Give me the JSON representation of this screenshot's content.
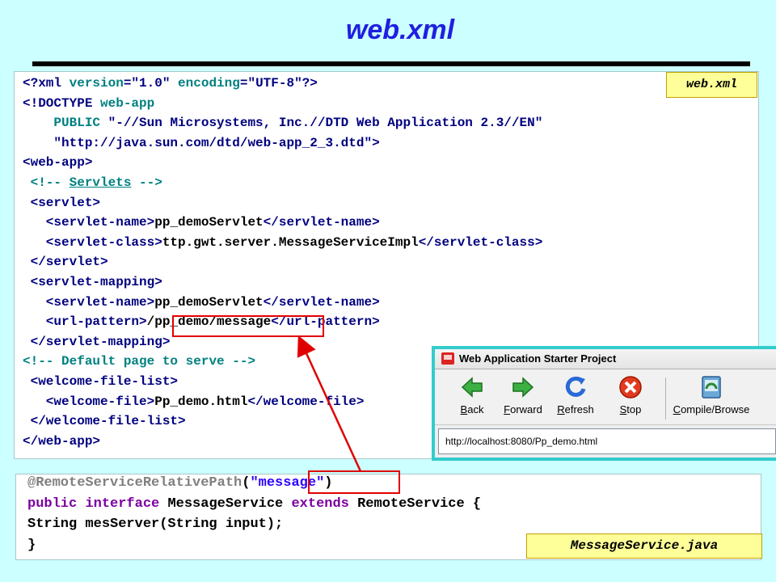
{
  "page": {
    "title": "web.xml"
  },
  "xml_code": {
    "lines": [
      [
        {
          "c": "tag",
          "t": "<?xml "
        },
        {
          "c": "attr",
          "t": "version"
        },
        {
          "c": "tag",
          "t": "=\""
        },
        {
          "c": "str",
          "t": "1.0"
        },
        {
          "c": "tag",
          "t": "\" "
        },
        {
          "c": "attr",
          "t": "encoding"
        },
        {
          "c": "tag",
          "t": "=\""
        },
        {
          "c": "str",
          "t": "UTF-8"
        },
        {
          "c": "tag",
          "t": "\"?>"
        }
      ],
      [
        {
          "c": "tag",
          "t": "<!DOCTYPE "
        },
        {
          "c": "attr",
          "t": "web-app"
        }
      ],
      [
        {
          "c": "txt",
          "t": "    "
        },
        {
          "c": "attr",
          "t": "PUBLIC "
        },
        {
          "c": "str",
          "t": "\"-//Sun Microsystems, Inc.//DTD Web Application 2.3//EN\""
        }
      ],
      [
        {
          "c": "txt",
          "t": "    "
        },
        {
          "c": "str",
          "t": "\"http://java.sun.com/dtd/web-app_2_3.dtd\""
        },
        {
          "c": "tag",
          "t": ">"
        }
      ],
      [
        {
          "c": "tag",
          "t": "<web-app>"
        }
      ],
      [
        {
          "c": "cmt",
          "t": " <!-- "
        },
        {
          "c": "cmt uline",
          "t": "Servlets"
        },
        {
          "c": "cmt",
          "t": " -->"
        }
      ],
      [
        {
          "c": "tag",
          "t": " <servlet>"
        }
      ],
      [
        {
          "c": "tag",
          "t": "   <servlet-name>"
        },
        {
          "c": "txt",
          "t": "pp_demoServlet"
        },
        {
          "c": "tag",
          "t": "</servlet-name>"
        }
      ],
      [
        {
          "c": "tag",
          "t": "   <servlet-class>"
        },
        {
          "c": "txt",
          "t": "ttp.gwt.server.MessageServiceImpl"
        },
        {
          "c": "tag",
          "t": "</servlet-class>"
        }
      ],
      [
        {
          "c": "tag",
          "t": " </servlet>"
        }
      ],
      [
        {
          "c": "tag",
          "t": " <servlet-mapping>"
        }
      ],
      [
        {
          "c": "tag",
          "t": "   <servlet-name>"
        },
        {
          "c": "txt",
          "t": "pp_demoServlet"
        },
        {
          "c": "tag",
          "t": "</servlet-name>"
        }
      ],
      [
        {
          "c": "tag",
          "t": "   <url-pattern>"
        },
        {
          "c": "txt",
          "t": "/pp_demo/message"
        },
        {
          "c": "tag",
          "t": "</url-pattern>"
        }
      ],
      [
        {
          "c": "tag",
          "t": " </servlet-mapping>"
        }
      ],
      [
        {
          "c": "cmt",
          "t": "<!-- Default page to serve -->"
        }
      ],
      [
        {
          "c": "tag",
          "t": " <welcome-file-list>"
        }
      ],
      [
        {
          "c": "tag",
          "t": "   <welcome-file>"
        },
        {
          "c": "txt",
          "t": "Pp_demo.html"
        },
        {
          "c": "tag",
          "t": "</welcome-file>"
        }
      ],
      [
        {
          "c": "tag",
          "t": " </welcome-file-list>"
        }
      ],
      [
        {
          "c": "tag",
          "t": "</web-app>"
        }
      ]
    ]
  },
  "java_code": {
    "lines": [
      [
        {
          "c": "anno",
          "t": "@RemoteServiceRelativePath"
        },
        {
          "c": "txt",
          "t": "("
        },
        {
          "c": "jstr",
          "t": "\"message\""
        },
        {
          "c": "txt",
          "t": ")"
        }
      ],
      [
        {
          "c": "kw",
          "t": "public interface "
        },
        {
          "c": "txt",
          "t": "MessageService "
        },
        {
          "c": "kw",
          "t": "extends "
        },
        {
          "c": "txt",
          "t": "RemoteService {"
        }
      ],
      [
        {
          "c": "txt",
          "t": "String mesServer(String input);"
        }
      ],
      [
        {
          "c": "txt",
          "t": "}"
        }
      ]
    ]
  },
  "labels": {
    "web_xml": "web.xml",
    "java_file": "MessageService.java"
  },
  "browser": {
    "window_title": "Web Application Starter Project",
    "toolbar": [
      {
        "label": "Back",
        "underline": "B",
        "rest": "ack",
        "icon": "back-arrow-icon"
      },
      {
        "label": "Forward",
        "underline": "F",
        "rest": "orward",
        "icon": "forward-arrow-icon"
      },
      {
        "label": "Refresh",
        "underline": "R",
        "rest": "efresh",
        "icon": "refresh-icon"
      },
      {
        "label": "Stop",
        "underline": "S",
        "rest": "top",
        "icon": "stop-icon"
      },
      {
        "label": "Compile/Browse",
        "underline": "C",
        "rest": "ompile/Browse",
        "icon": "compile-browse-icon"
      }
    ],
    "address": "http://localhost:8080/Pp_demo.html"
  },
  "colors": {
    "background": "#ccffff",
    "title": "#1f1fe0",
    "highlight": "#e00000",
    "label_bg": "#ffff99"
  }
}
